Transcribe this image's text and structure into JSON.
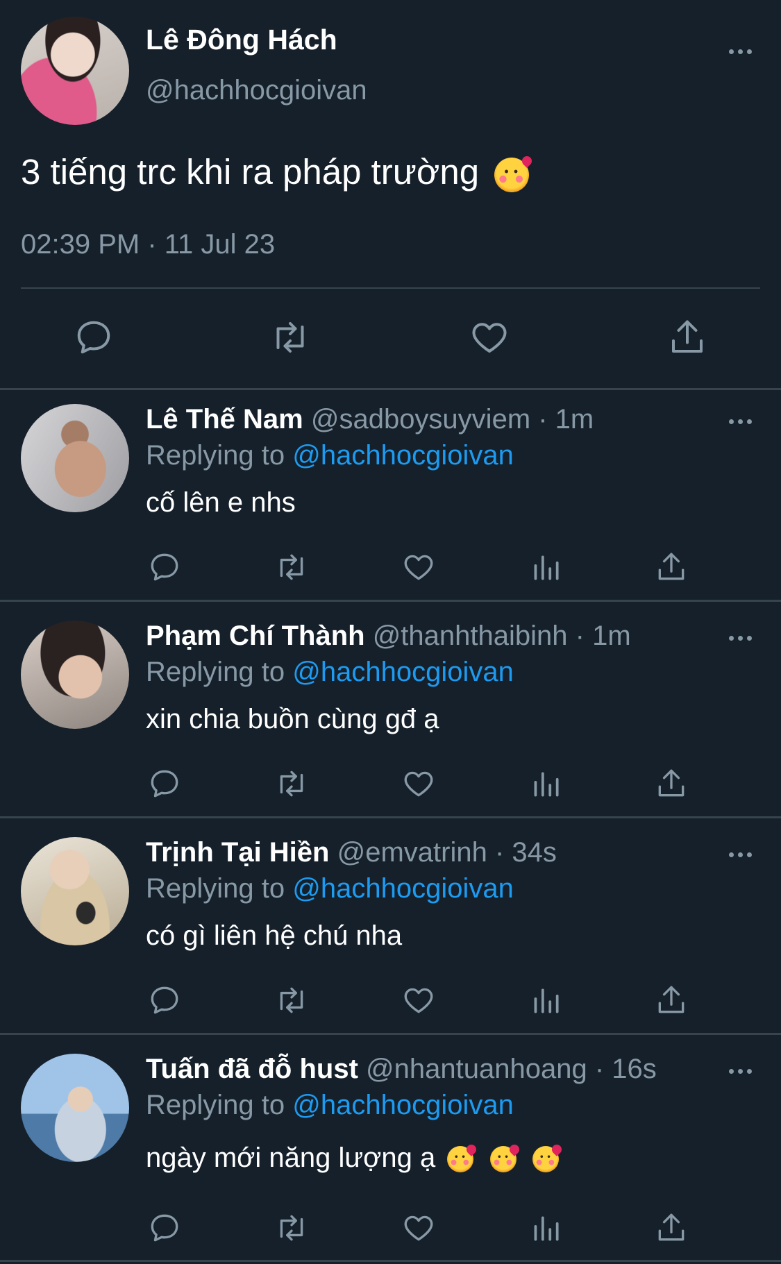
{
  "main_tweet": {
    "author_name": "Lê Đông Hách",
    "author_handle": "@hachhocgioivan",
    "text": "3 tiếng trc khi ra pháp trường",
    "emoji": "smiling-face-with-hearts",
    "timestamp": "02:39 PM · 11 Jul 23",
    "actions": [
      "reply-icon",
      "retweet-icon",
      "like-icon",
      "share-icon"
    ]
  },
  "replies": [
    {
      "name": "Lê Thế Nam",
      "handle_time": "@sadboysuyviem · 1m",
      "replying_prefix": "Replying to",
      "mention": "@hachhocgioivan",
      "text": "cố lên e nhs"
    },
    {
      "name": "Phạm Chí Thành",
      "handle_time": "@thanhthaibinh · 1m",
      "replying_prefix": "Replying to",
      "mention": "@hachhocgioivan",
      "text": "xin chia buồn cùng gđ ạ"
    },
    {
      "name": "Trịnh Tại Hiền",
      "handle_time": "@emvatrinh · 34s",
      "replying_prefix": "Replying to",
      "mention": "@hachhocgioivan",
      "text": "có gì liên hệ chú nha"
    },
    {
      "name": "Tuấn đã đỗ hust",
      "handle_time": "@nhantuanhoang · 16s",
      "replying_prefix": "Replying to",
      "mention": "@hachhocgioivan",
      "text": "ngày mới năng lượng ạ",
      "emoji_count": 3
    }
  ],
  "colors": {
    "background": "#15202b",
    "secondary_text": "#8899a6",
    "mention": "#1d9bf0",
    "divider": "#38444d"
  }
}
